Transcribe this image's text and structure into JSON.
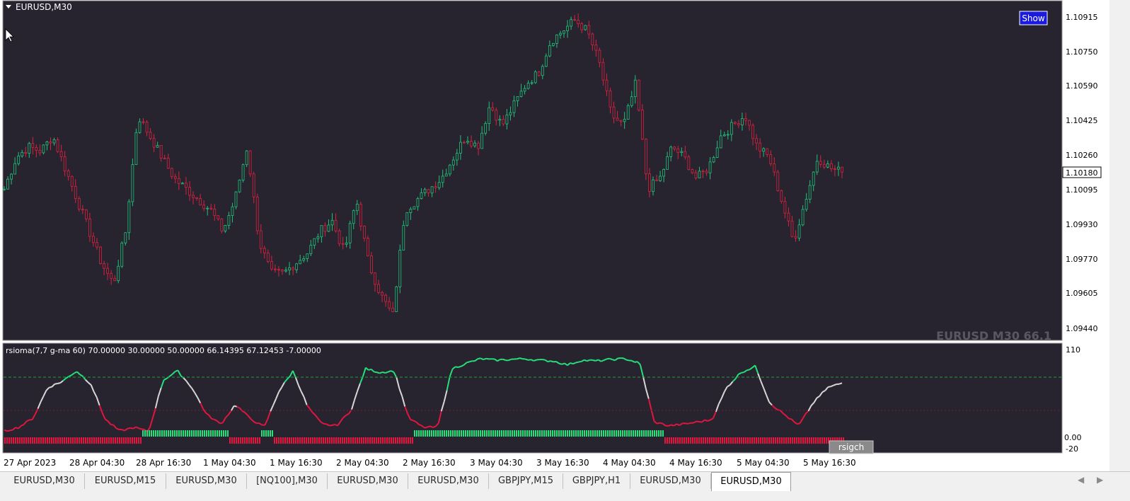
{
  "main_chart": {
    "symbol_label": "EURUSD,M30",
    "show_button": "Show",
    "watermark": "EURUSD M30  66.1",
    "price_levels": [
      "1.10915",
      "1.10750",
      "1.10590",
      "1.10425",
      "1.10260",
      "1.10095",
      "1.09930",
      "1.09770",
      "1.09605",
      "1.09440"
    ],
    "current_price": "1.10180"
  },
  "indicator": {
    "label": "rsioma(7,7 g-ma 60) 70.00000 30.00000 50.00000 66.14395 67.12453 -7.00000",
    "levels": [
      "110",
      "0.00",
      "-20"
    ],
    "button": "rsigch"
  },
  "time_axis": [
    "27 Apr 2023",
    "28 Apr 04:30",
    "28 Apr 16:30",
    "1 May 04:30",
    "1 May 16:30",
    "2 May 04:30",
    "2 May 16:30",
    "3 May 04:30",
    "3 May 16:30",
    "4 May 04:30",
    "4 May 16:30",
    "5 May 04:30",
    "5 May 16:30"
  ],
  "tabs": [
    "EURUSD,M30",
    "EURUSD,M15",
    "EURUSD,M30",
    "[NQ100],M30",
    "EURUSD,M30",
    "EURUSD,M30",
    "GBPJPY,M15",
    "GBPJPY,H1",
    "EURUSD,M30",
    "EURUSD,M30"
  ],
  "active_tab_index": 9,
  "colors": {
    "background": "#27232f",
    "bull": "#1fc27a",
    "bear": "#d8223f",
    "rsi_up": "#25e07a",
    "rsi_down": "#e0173f",
    "rsi_neutral": "#d7d7d7"
  },
  "chart_data": [
    {
      "type": "candlestick",
      "title": "EURUSD,M30",
      "ylim": [
        1.0935,
        1.1102
      ],
      "x_tick_labels": [
        "27 Apr 2023",
        "28 Apr 04:30",
        "28 Apr 16:30",
        "1 May 04:30",
        "1 May 16:30",
        "2 May 04:30",
        "2 May 16:30",
        "3 May 04:30",
        "3 May 16:30",
        "4 May 04:30",
        "4 May 16:30",
        "5 May 04:30",
        "5 May 16:30"
      ],
      "close_path_approx": [
        1.101,
        1.1025,
        1.103,
        1.1028,
        1.1035,
        1.102,
        1.1005,
        1.099,
        1.0975,
        1.0965,
        1.099,
        1.1045,
        1.1035,
        1.1025,
        1.1015,
        1.101,
        1.1005,
        1.1,
        1.099,
        1.1005,
        1.103,
        1.0985,
        1.097,
        1.097,
        1.0975,
        1.098,
        1.099,
        1.0995,
        1.098,
        1.1005,
        1.0975,
        1.096,
        1.095,
        1.1,
        1.1005,
        1.101,
        1.1015,
        1.1025,
        1.1035,
        1.103,
        1.105,
        1.104,
        1.105,
        1.106,
        1.1065,
        1.108,
        1.1085,
        1.109,
        1.1085,
        1.107,
        1.1045,
        1.104,
        1.106,
        1.101,
        1.1015,
        1.103,
        1.1025,
        1.1015,
        1.102,
        1.1035,
        1.104,
        1.1045,
        1.103,
        1.1025,
        1.1005,
        1.0985,
        1.1005,
        1.1025,
        1.102,
        1.1018
      ],
      "last_price": 1.1018
    },
    {
      "type": "line",
      "title": "rsioma(7,7 g-ma 60)",
      "ylim": [
        -20,
        110
      ],
      "levels": [
        70,
        30,
        50
      ],
      "values_approx": [
        3,
        8,
        20,
        60,
        68,
        82,
        65,
        18,
        3,
        8,
        2,
        70,
        82,
        60,
        25,
        12,
        38,
        20,
        8,
        55,
        82,
        35,
        12,
        10,
        30,
        85,
        80,
        82,
        20,
        8,
        8,
        85,
        92,
        98,
        96,
        97,
        98,
        96,
        95,
        90,
        96,
        95,
        97,
        98,
        92,
        15,
        10,
        12,
        15,
        18,
        60,
        80,
        88,
        40,
        25,
        10,
        40,
        60,
        66
      ],
      "signal_bars": "up/down histogram at bottom"
    }
  ]
}
